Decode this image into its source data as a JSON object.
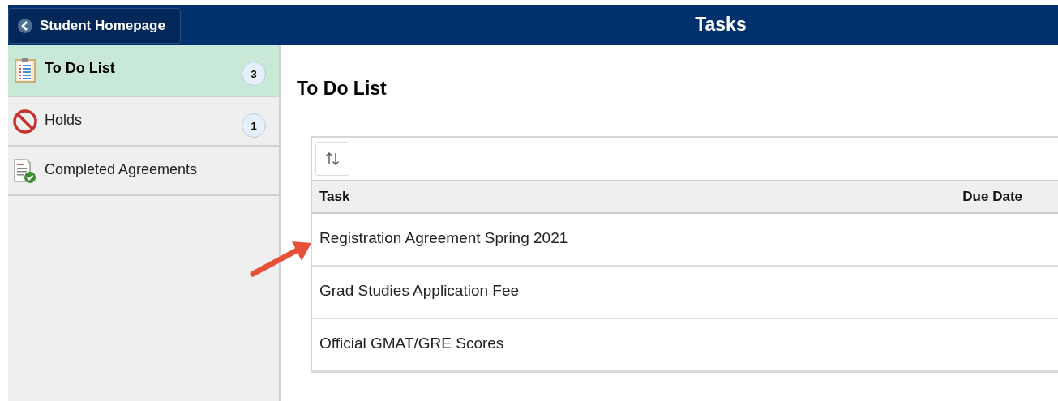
{
  "header": {
    "back_button": "Student Homepage",
    "title": "Tasks"
  },
  "sidebar": {
    "items": [
      {
        "kind": "clipboard",
        "label": "To Do List",
        "badge": "3",
        "selected": true
      },
      {
        "kind": "prohibited",
        "label": "Holds",
        "badge": "1",
        "selected": false
      },
      {
        "kind": "document-check",
        "label": "Completed Agreements",
        "selected": false
      }
    ]
  },
  "main": {
    "heading": "To Do List",
    "table": {
      "columns": [
        "Task",
        "Due Date"
      ],
      "rows": [
        {
          "task": "Registration Agreement Spring 2021"
        },
        {
          "task": "Grad Studies Application Fee"
        },
        {
          "task": "Official GMAT/GRE Scores"
        }
      ]
    }
  }
}
